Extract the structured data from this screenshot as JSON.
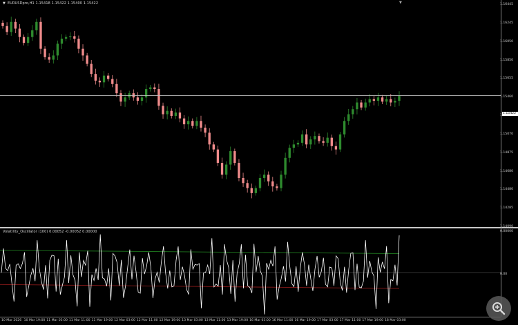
{
  "chart_header": {
    "arrow": "▼",
    "text": "EURUSDpro,H1  1.15418 1.15422 1.15400 1.15422"
  },
  "indicator_header": {
    "text": "Volatility_Oscillator (100) 0.00052 -0.00052 0.00000"
  },
  "price_axis": [
    "1.16445",
    "1.16245",
    "1.16050",
    "1.15850",
    "1.15655",
    "1.15460",
    "1.15265",
    "1.15070",
    "1.14875",
    "1.14680",
    "1.14480",
    "1.14285",
    "1.14090"
  ],
  "current_price": "1.15422",
  "sub_axis": {
    "top": "0.00000",
    "mid": "0.00"
  },
  "time_axis": [
    "10 Mar 2026",
    "10 Mar 19:00",
    "11 Mar 03:00",
    "11 Mar 11:00",
    "11 Mar 19:00",
    "12 Mar 03:00",
    "12 Mar 11:00",
    "12 Mar 19:00",
    "13 Mar 03:00",
    "13 Mar 11:00",
    "13 Mar 19:00",
    "16 Mar 03:00",
    "16 Mar 11:00",
    "16 Mar 19:00",
    "17 Mar 03:00",
    "17 Mar 11:00",
    "17 Mar 19:00",
    "18 Mar 03:00"
  ],
  "colors": {
    "bull": "#2e8b2e",
    "bear": "#f08c8c",
    "osc": "#ffffff",
    "upper": "#1f7a1f",
    "lower": "#8b1a1a"
  },
  "icons": {
    "zoom": "magnifier-plus-icon",
    "scroll": "triangle-down-icon"
  },
  "chart_data": {
    "type": "candlestick",
    "symbol_timeframe": "EURUSDpro,H1",
    "ohlc_last": {
      "open": 1.15418,
      "high": 1.15422,
      "low": 1.154,
      "close": 1.15422
    },
    "price_range": [
      1.1393,
      1.1652
    ],
    "closes": [
      1.1625,
      1.1618,
      1.163,
      1.1622,
      1.1612,
      1.1605,
      1.1612,
      1.162,
      1.163,
      1.1598,
      1.1588,
      1.1585,
      1.159,
      1.1604,
      1.161,
      1.1612,
      1.1613,
      1.161,
      1.1598,
      1.159,
      1.158,
      1.1568,
      1.156,
      1.1558,
      1.1566,
      1.1562,
      1.1556,
      1.1545,
      1.1535,
      1.154,
      1.1545,
      1.154,
      1.1536,
      1.154,
      1.155,
      1.1552,
      1.155,
      1.153,
      1.152,
      1.1524,
      1.1518,
      1.1522,
      1.1515,
      1.1508,
      1.1512,
      1.1506,
      1.1512,
      1.1504,
      1.1498,
      1.1484,
      1.1478,
      1.1462,
      1.1448,
      1.146,
      1.1476,
      1.1462,
      1.1444,
      1.1438,
      1.1432,
      1.1426,
      1.1432,
      1.1444,
      1.1448,
      1.144,
      1.1434,
      1.1432,
      1.1448,
      1.1468,
      1.148,
      1.1484,
      1.1486,
      1.1496,
      1.1484,
      1.149,
      1.1494,
      1.1488,
      1.1486,
      1.1492,
      1.1482,
      1.1478,
      1.1496,
      1.1512,
      1.152,
      1.1526,
      1.1534,
      1.1528,
      1.1534,
      1.1538,
      1.1536,
      1.154,
      1.1535,
      1.1538,
      1.1534,
      1.1536,
      1.1542
    ],
    "oscillator": {
      "range": [
        -0.00052,
        0.00052
      ],
      "upper": 0.00028,
      "lower": -0.0002
    }
  }
}
